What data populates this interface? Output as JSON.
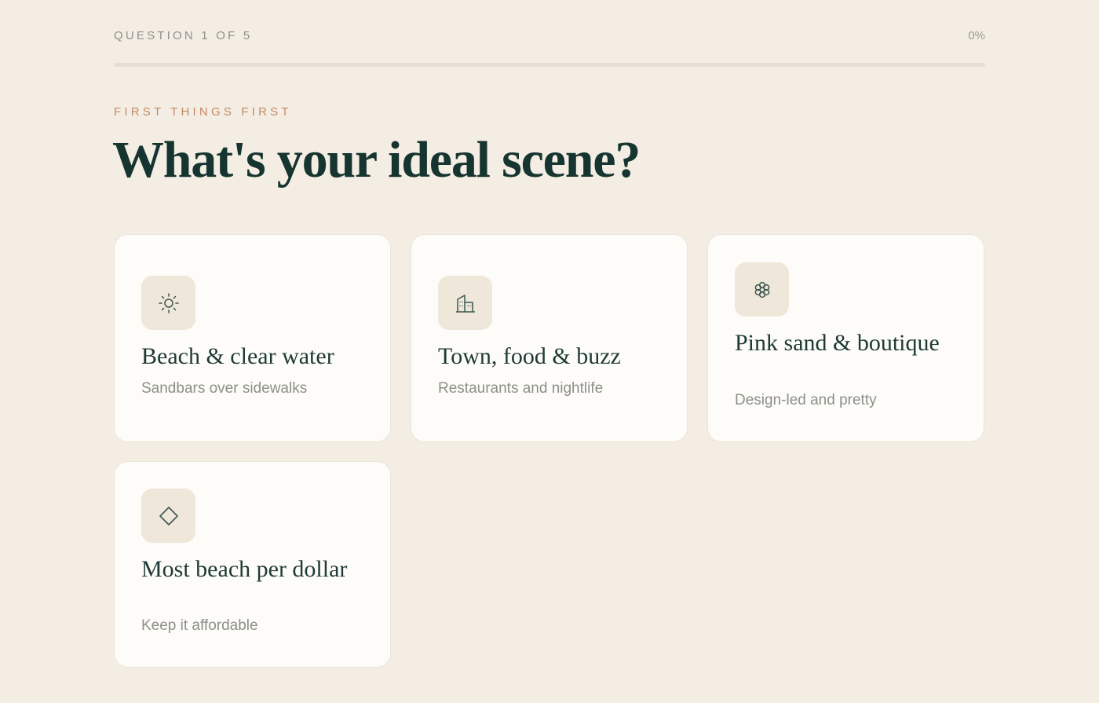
{
  "progress": {
    "question_label": "QUESTION 1 OF 5",
    "percent_label": "0%",
    "value": 0
  },
  "question": {
    "eyebrow": "FIRST THINGS FIRST",
    "title": "What's your ideal scene?"
  },
  "options": [
    {
      "icon": "sun-icon",
      "title": "Beach & clear water",
      "subtitle": "Sandbars over sidewalks"
    },
    {
      "icon": "building-icon",
      "title": "Town, food & buzz",
      "subtitle": "Restaurants and nightlife"
    },
    {
      "icon": "flower-icon",
      "title": "Pink sand & boutique",
      "subtitle": "Design-led and pretty"
    },
    {
      "icon": "diamond-icon",
      "title": "Most beach per dollar",
      "subtitle": "Keep it affordable"
    }
  ],
  "colors": {
    "background": "#f3ede3",
    "card": "#fdfcf9",
    "icon_tile": "#efe7da",
    "accent": "#c58a64",
    "heading": "#163430"
  }
}
